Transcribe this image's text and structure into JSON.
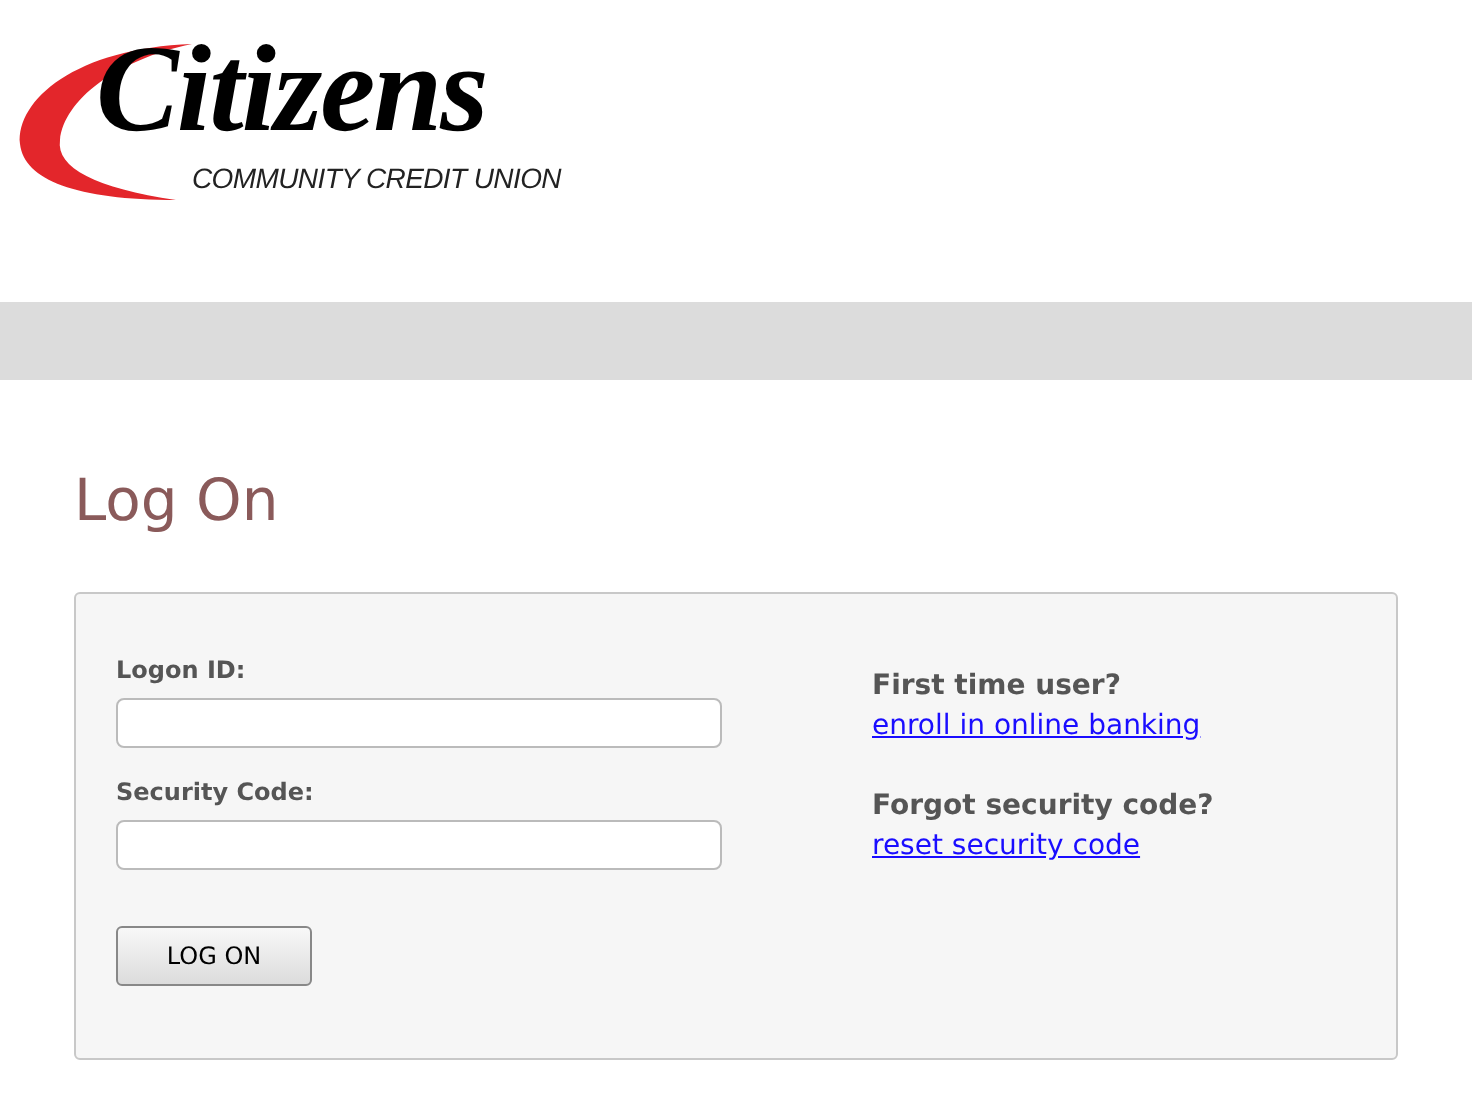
{
  "logo": {
    "name": "Citizens",
    "tagline": "COMMUNITY CREDIT UNION"
  },
  "page_title": "Log On",
  "form": {
    "fields": [
      {
        "label": "Logon ID:"
      },
      {
        "label": "Security Code:"
      }
    ],
    "submit": "LOG ON"
  },
  "help": [
    {
      "question": "First time user?",
      "link": "enroll in online banking"
    },
    {
      "question": "Forgot security code?",
      "link": "reset security code"
    }
  ]
}
